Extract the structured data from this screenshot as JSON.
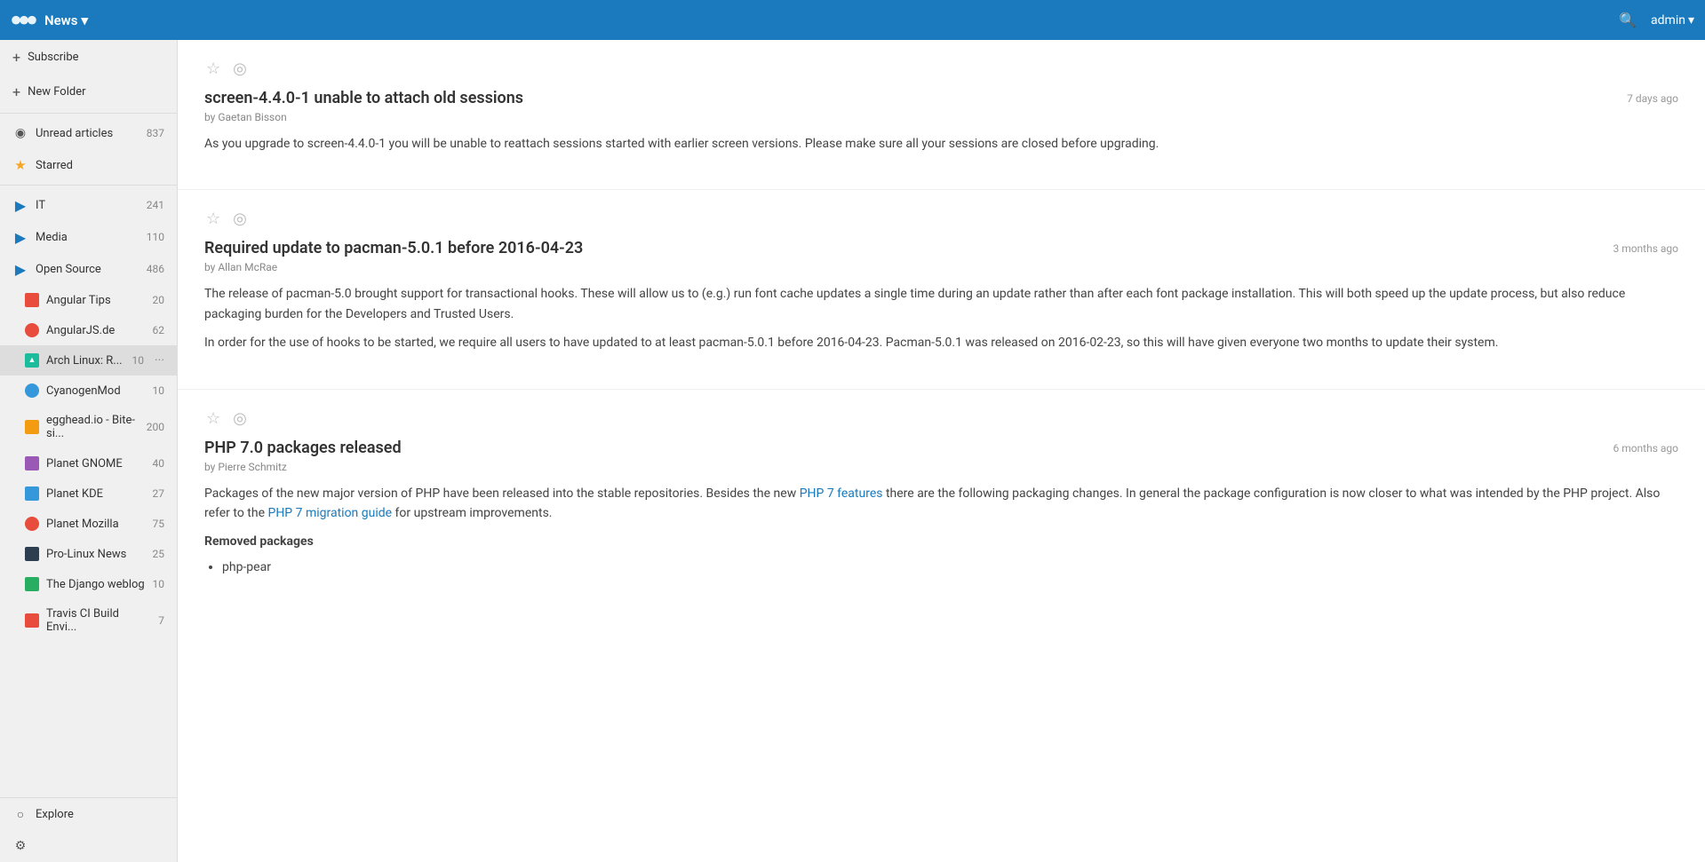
{
  "topbar": {
    "app_name": "News",
    "chevron": "▾",
    "search_title": "Search",
    "admin_label": "admin",
    "admin_chevron": "▾"
  },
  "sidebar": {
    "subscribe_label": "Subscribe",
    "new_folder_label": "New Folder",
    "items": [
      {
        "id": "unread",
        "label": "Unread articles",
        "count": "837",
        "icon": "rss",
        "active": false
      },
      {
        "id": "starred",
        "label": "Starred",
        "count": "",
        "icon": "star",
        "active": false
      },
      {
        "id": "it",
        "label": "IT",
        "count": "241",
        "icon": "folder",
        "active": false
      },
      {
        "id": "media",
        "label": "Media",
        "count": "110",
        "icon": "folder",
        "active": false
      },
      {
        "id": "opensource",
        "label": "Open Source",
        "count": "486",
        "icon": "folder",
        "active": false
      }
    ],
    "feeds": [
      {
        "id": "angular-tips",
        "label": "Angular Tips",
        "count": "20",
        "color": "#e74c3c"
      },
      {
        "id": "angularjs-de",
        "label": "AngularJS.de",
        "count": "62",
        "color": "#e74c3c"
      },
      {
        "id": "arch-linux",
        "label": "Arch Linux: R...",
        "count": "10",
        "color": "#1abc9c",
        "active": true,
        "more": "···"
      },
      {
        "id": "cyanogenmod",
        "label": "CyanogenMod",
        "count": "10",
        "color": "#3498db"
      },
      {
        "id": "egghead-io",
        "label": "egghead.io - Bite-si...",
        "count": "200",
        "color": "#f39c12"
      },
      {
        "id": "planet-gnome",
        "label": "Planet GNOME",
        "count": "40",
        "color": "#9b59b6"
      },
      {
        "id": "planet-kde",
        "label": "Planet KDE",
        "count": "27",
        "color": "#3498db"
      },
      {
        "id": "planet-mozilla",
        "label": "Planet Mozilla",
        "count": "75",
        "color": "#e74c3c"
      },
      {
        "id": "pro-linux-news",
        "label": "Pro-Linux News",
        "count": "25",
        "color": "#2c3e50"
      },
      {
        "id": "django-weblog",
        "label": "The Django weblog",
        "count": "10",
        "color": "#27ae60"
      },
      {
        "id": "travis-ci",
        "label": "Travis CI Build Envi...",
        "count": "7",
        "color": "#e74c3c"
      }
    ],
    "explore_label": "Explore"
  },
  "articles": [
    {
      "id": "article-1",
      "title": "screen-4.4.0-1 unable to attach old sessions",
      "author": "Gaetan Bisson",
      "date": "7 days ago",
      "starred": false,
      "body_paragraphs": [
        "As you upgrade to screen-4.4.0-1 you will be unable to reattach sessions started with earlier screen versions. Please make sure all your sessions are closed before upgrading."
      ],
      "links": [],
      "section_title": "",
      "list_items": []
    },
    {
      "id": "article-2",
      "title": "Required update to pacman-5.0.1 before 2016-04-23",
      "author": "Allan McRae",
      "date": "3 months ago",
      "starred": false,
      "body_paragraphs": [
        "The release of pacman-5.0 brought support for transactional hooks. These will allow us to (e.g.) run font cache updates a single time during an update rather than after each font package installation. This will both speed up the update process, but also reduce packaging burden for the Developers and Trusted Users.",
        "In order for the use of hooks to be started, we require all users to have updated to at least pacman-5.0.1 before 2016-04-23. Pacman-5.0.1 was released on 2016-02-23, so this will have given everyone two months to update their system."
      ],
      "links": [],
      "section_title": "",
      "list_items": []
    },
    {
      "id": "article-3",
      "title": "PHP 7.0 packages released",
      "author": "Pierre Schmitz",
      "date": "6 months ago",
      "starred": false,
      "body_paragraphs": [
        "Packages of the new major version of PHP have been released into the stable repositories. Besides the new",
        "there are the following packaging changes. In general the package configuration is now closer to what was intended by the PHP project. Also refer to the",
        "for upstream improvements."
      ],
      "links": [
        {
          "text": "PHP 7 features",
          "url": "#"
        },
        {
          "text": "PHP 7 migration guide",
          "url": "#"
        }
      ],
      "section_title": "Removed packages",
      "list_items": [
        "php-pear"
      ]
    }
  ],
  "icons": {
    "star_empty": "☆",
    "star_filled": "★",
    "eye": "◎",
    "search": "🔍",
    "settings": "⚙",
    "explore": "○",
    "rss": "◉",
    "folder": "▶",
    "plus": "+",
    "more_dots": "···"
  }
}
